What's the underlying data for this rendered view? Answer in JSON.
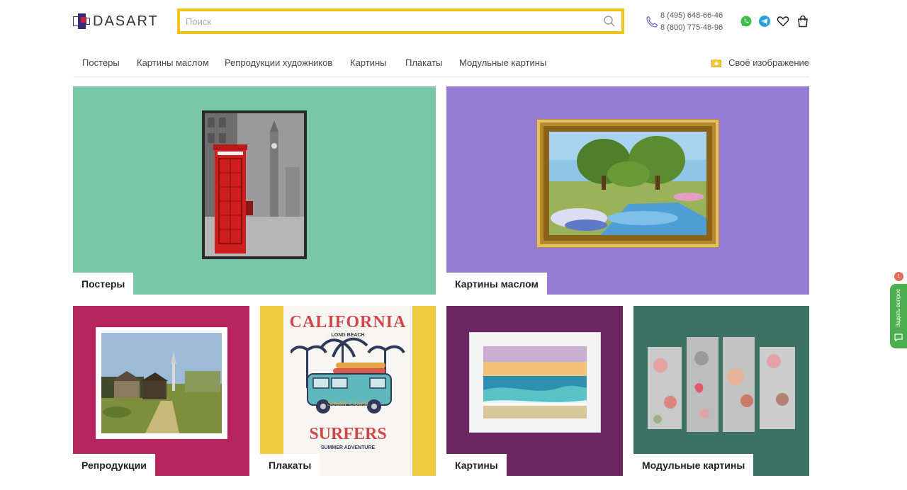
{
  "header": {
    "logo_text": "DASART",
    "search": {
      "placeholder": "Поиск",
      "value": ""
    },
    "phones": [
      "8 (495) 648-66-46",
      "8 (800) 775-48-96"
    ],
    "icons": [
      "phone-icon",
      "whatsapp-icon",
      "telegram-icon",
      "heart-icon",
      "cart-icon"
    ]
  },
  "nav": {
    "items": [
      {
        "label": "Постеры"
      },
      {
        "label": "Картины маслом"
      },
      {
        "label": "Репродукции художников"
      },
      {
        "label": "Картины"
      },
      {
        "label": "Плакаты"
      },
      {
        "label": "Модульные картины"
      }
    ],
    "own_image": "Своё изображение"
  },
  "tiles": [
    {
      "label": "Постеры",
      "bg": "#78c8a7"
    },
    {
      "label": "Картины маслом",
      "bg": "#967cd6"
    },
    {
      "label": "Репродукции",
      "bg": "#b8245e"
    },
    {
      "label": "Плакаты",
      "bg": "#f1cb3f"
    },
    {
      "label": "Картины",
      "bg": "#6c2762"
    },
    {
      "label": "Модульные картины",
      "bg": "#3c7261"
    }
  ],
  "poster_art": {
    "title": "CALIFORNIA",
    "subtitle": "LONG BEACH",
    "car_text": "South Coast",
    "bottom": "SURFERS",
    "tagline": "SUMMER ADVENTURE"
  },
  "chat": {
    "label": "Задать вопрос",
    "badge": "1"
  },
  "colors": {
    "accent": "#f2c31e",
    "chat": "#4cae4f"
  }
}
